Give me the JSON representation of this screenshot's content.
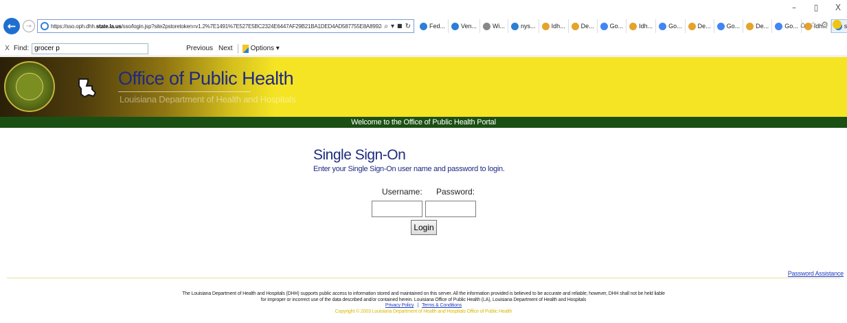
{
  "browser": {
    "window_controls": {
      "minimize": "–",
      "restore": "▯",
      "close": "X"
    },
    "url": "https://sso.oph.dhh.state.la.us/sso/login.jsp?site2pstoretoken=v1.2%7E1491%7E527E5BC2324E6447AF29B21BA1DED4AD587755E8A8992470B0A92B9DF",
    "url_parts": {
      "prefix": "https://sso.oph.dhh.",
      "domain": "state.la.us",
      "suffix": "/sso/login.jsp?site2pstoretoken=v1.2%7E1491%7E527E5BC2324E6447AF29B21BA1DED4AD587755E8A8992470B0A92B9DF"
    },
    "url_tools": {
      "search": "⌕",
      "dropdown": "▾",
      "lock": "🔒",
      "refresh": "↻"
    },
    "tabs": [
      {
        "label": "Fed...",
        "icon_color": "#2d7ed6"
      },
      {
        "label": "Ven...",
        "icon_color": "#2d7ed6"
      },
      {
        "label": "Wi...",
        "icon_color": "#888888"
      },
      {
        "label": "nys...",
        "icon_color": "#2d7ed6"
      },
      {
        "label": "Idh...",
        "icon_color": "#e5a32b"
      },
      {
        "label": "De...",
        "icon_color": "#e5a32b"
      },
      {
        "label": "Go...",
        "icon_color": "#4285f4"
      },
      {
        "label": "Idh...",
        "icon_color": "#e5a32b"
      },
      {
        "label": "Go...",
        "icon_color": "#4285f4"
      },
      {
        "label": "De...",
        "icon_color": "#e5a32b"
      },
      {
        "label": "Go...",
        "icon_color": "#4285f4"
      },
      {
        "label": "De...",
        "icon_color": "#e5a32b"
      },
      {
        "label": "Go...",
        "icon_color": "#4285f4"
      },
      {
        "label": "Idh...",
        "icon_color": "#e5a32b"
      }
    ],
    "active_tab": {
      "label": "s...",
      "close": "×"
    },
    "right_icons": {
      "home": "⌂",
      "favorites": "☆",
      "settings": "⚙"
    }
  },
  "findbar": {
    "close": "X",
    "label": "Find:",
    "value": "grocer p",
    "previous": "Previous",
    "next": "Next",
    "options": "Options ▾"
  },
  "site": {
    "title": "Office of Public Health",
    "subtitle": "Louisiana Department of Health and Hospitals",
    "seal_text": "OFFICE OF PUBLIC HEALTH",
    "welcome": "Welcome to the Office of Public Health Portal"
  },
  "login": {
    "title": "Single Sign-On",
    "instructions": "Enter your Single Sign-On user name and password to login.",
    "username_label": "Username:",
    "password_label": "Password:",
    "username_value": "",
    "password_value": "",
    "button": "Login"
  },
  "links": {
    "password_assistance": "Password Assistance"
  },
  "footer": {
    "disclaimer_1": "The Louisiana Department of Health and Hospitals (DHH) supports public access to information stored and maintained on this server. All the information provided is believed to be accurate and reliable; however, DHH shall not be held liable",
    "disclaimer_2": "for improper or incorrect use of the data described and/or contained herein. Louisiana Office of Public Health (LA), Louisiana Department of Health and Hospitals",
    "privacy": "Privacy Policy",
    "separator": "|",
    "terms": "Terms & Conditions",
    "copyright": "Copyright © 2003 Louisiana Department of Health and Hospitals Office of Public Health"
  },
  "colors": {
    "banner_yellow": "#f5e424",
    "title_blue": "#1e2a80",
    "welcome_green": "#1b5014",
    "link_blue": "#1f3cc2",
    "copyright_gold": "#d7b800"
  }
}
